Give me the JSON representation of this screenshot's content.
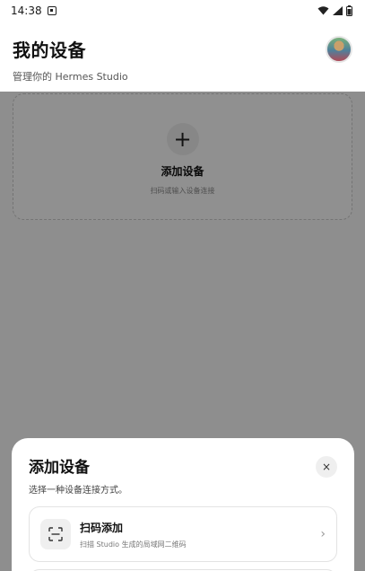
{
  "status_bar": {
    "time": "14:38"
  },
  "header": {
    "title": "我的设备",
    "subtitle": "管理你的 Hermes Studio"
  },
  "add_device_card": {
    "plus": "+",
    "title": "添加设备",
    "hint": "扫码或输入设备连接"
  },
  "sheet": {
    "title": "添加设备",
    "subtitle": "选择一种设备连接方式。",
    "close": "×",
    "options": [
      {
        "icon": "scan-icon",
        "title": "扫码添加",
        "desc": "扫描 Studio 生成的局域网二维码",
        "chevron": "›"
      }
    ]
  }
}
